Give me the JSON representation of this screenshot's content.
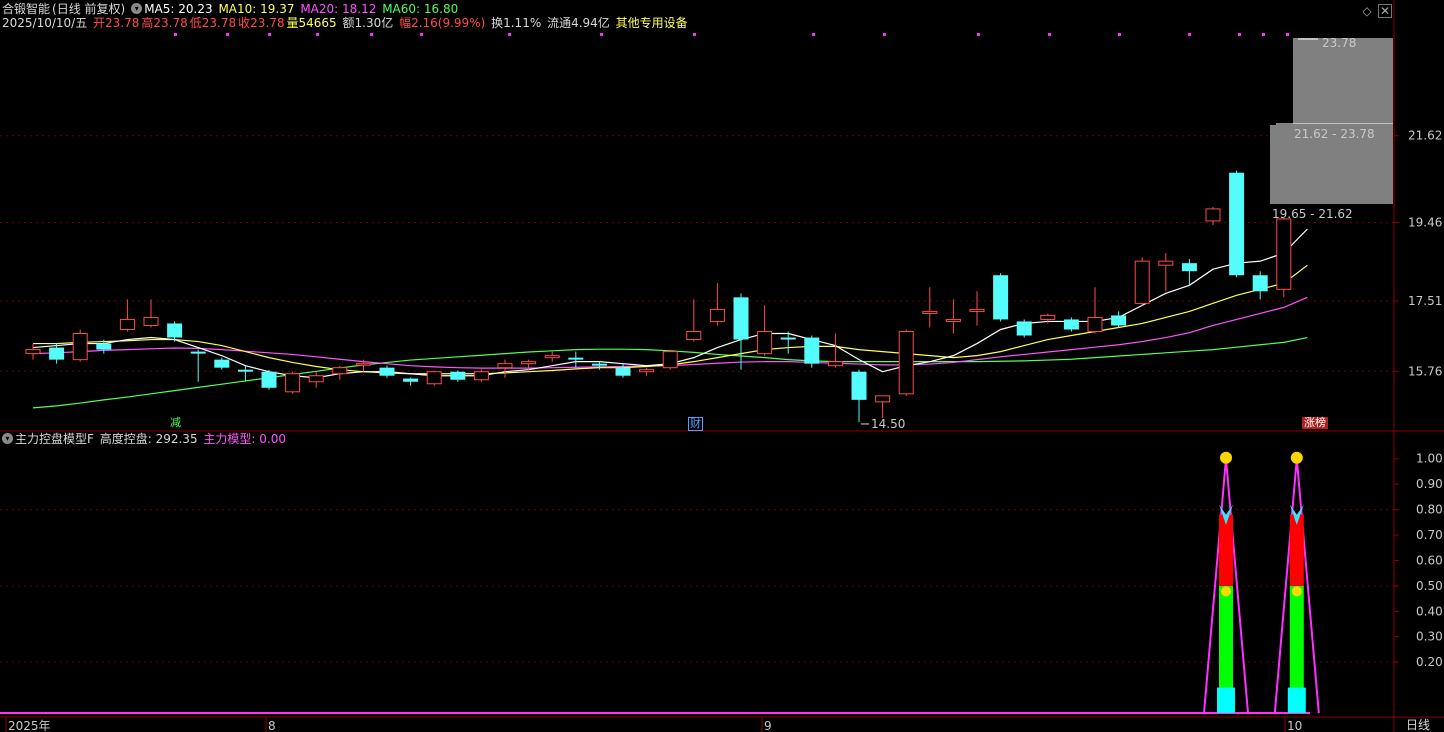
{
  "stock": {
    "name": "合锻智能",
    "period": "(日线 前复权)",
    "ma5_label": "MA5: 20.23",
    "ma10_label": "MA10: 19.37",
    "ma20_label": "MA20: 18.12",
    "ma60_label": "MA60: 16.80"
  },
  "info": {
    "date": "2025/10/10/五",
    "open": "开23.78",
    "high": "高23.78",
    "low": "低23.78",
    "close": "收23.78",
    "volume": "量54665",
    "amount": "额1.30亿",
    "change": "幅2.16(9.99%)",
    "turnover": "换1.11%",
    "float": "流通4.94亿",
    "industry": "其他专用设备"
  },
  "indicator": {
    "name": "主力控盘模型F",
    "item1": "高度控盘: 292.35",
    "item2": "主力模型: 0.00"
  },
  "price_axis": [
    "21.62",
    "19.46",
    "17.51",
    "15.76"
  ],
  "ind_axis": [
    "1.00",
    "0.90",
    "0.80",
    "0.70",
    "0.60",
    "0.50",
    "0.40",
    "0.30",
    "0.20"
  ],
  "time_axis": [
    "2025年",
    "8",
    "9",
    "10"
  ],
  "period_button": "日线",
  "price_box_labels": {
    "top": "23.78",
    "range1": "21.62 - 23.78",
    "range2": "19.65 - 21.62"
  },
  "low_marker": "14.50",
  "event_marks": {
    "jian": "减",
    "cai": "财",
    "zhangbang": "涨榜"
  },
  "colors": {
    "up": "#ff4a4a",
    "down": "#54fcfc",
    "ma5": "#ffffff",
    "ma10": "#ffff54",
    "ma20": "#ff54ff",
    "ma60": "#54ff54",
    "grid": "#8b0000"
  },
  "chart_data": {
    "type": "candlestick",
    "price_ylim": [
      14.3,
      24.2
    ],
    "candles": [
      {
        "o": 16.2,
        "c": 16.3,
        "h": 16.45,
        "l": 16.05
      },
      {
        "o": 16.35,
        "c": 16.05,
        "h": 16.45,
        "l": 15.95
      },
      {
        "o": 16.05,
        "c": 16.7,
        "h": 16.8,
        "l": 16.0
      },
      {
        "o": 16.45,
        "c": 16.3,
        "h": 16.55,
        "l": 16.2
      },
      {
        "o": 16.8,
        "c": 17.05,
        "h": 17.55,
        "l": 16.75
      },
      {
        "o": 16.9,
        "c": 17.1,
        "h": 17.55,
        "l": 16.85
      },
      {
        "o": 16.95,
        "c": 16.6,
        "h": 17.0,
        "l": 16.5
      },
      {
        "o": 16.25,
        "c": 16.2,
        "h": 16.3,
        "l": 15.5
      },
      {
        "o": 16.05,
        "c": 15.85,
        "h": 16.1,
        "l": 15.8
      },
      {
        "o": 15.8,
        "c": 15.75,
        "h": 15.9,
        "l": 15.5
      },
      {
        "o": 15.75,
        "c": 15.35,
        "h": 15.8,
        "l": 15.3
      },
      {
        "o": 15.25,
        "c": 15.7,
        "h": 15.75,
        "l": 15.2
      },
      {
        "o": 15.5,
        "c": 15.65,
        "h": 15.75,
        "l": 15.35
      },
      {
        "o": 15.7,
        "c": 15.85,
        "h": 15.9,
        "l": 15.55
      },
      {
        "o": 15.95,
        "c": 15.95,
        "h": 16.05,
        "l": 15.75
      },
      {
        "o": 15.85,
        "c": 15.65,
        "h": 15.9,
        "l": 15.6
      },
      {
        "o": 15.58,
        "c": 15.5,
        "h": 15.6,
        "l": 15.4
      },
      {
        "o": 15.45,
        "c": 15.75,
        "h": 15.78,
        "l": 15.4
      },
      {
        "o": 15.75,
        "c": 15.55,
        "h": 15.78,
        "l": 15.5
      },
      {
        "o": 15.55,
        "c": 15.75,
        "h": 15.8,
        "l": 15.5
      },
      {
        "o": 15.85,
        "c": 15.95,
        "h": 16.05,
        "l": 15.6
      },
      {
        "o": 15.95,
        "c": 16.0,
        "h": 16.05,
        "l": 15.8
      },
      {
        "o": 16.1,
        "c": 16.15,
        "h": 16.25,
        "l": 16.0
      },
      {
        "o": 16.1,
        "c": 16.05,
        "h": 16.25,
        "l": 15.85
      },
      {
        "o": 15.95,
        "c": 15.9,
        "h": 16.0,
        "l": 15.8
      },
      {
        "o": 15.85,
        "c": 15.65,
        "h": 15.95,
        "l": 15.6
      },
      {
        "o": 15.75,
        "c": 15.8,
        "h": 15.85,
        "l": 15.65
      },
      {
        "o": 15.85,
        "c": 16.25,
        "h": 16.3,
        "l": 15.8
      },
      {
        "o": 16.55,
        "c": 16.75,
        "h": 17.55,
        "l": 16.5
      },
      {
        "o": 17.0,
        "c": 17.3,
        "h": 17.95,
        "l": 16.9
      },
      {
        "o": 17.6,
        "c": 16.55,
        "h": 17.7,
        "l": 15.8
      },
      {
        "o": 16.2,
        "c": 16.75,
        "h": 17.4,
        "l": 16.15
      },
      {
        "o": 16.6,
        "c": 16.55,
        "h": 16.75,
        "l": 16.2
      },
      {
        "o": 16.6,
        "c": 15.95,
        "h": 16.65,
        "l": 15.85
      },
      {
        "o": 15.9,
        "c": 16.0,
        "h": 16.7,
        "l": 15.85
      },
      {
        "o": 15.75,
        "c": 15.05,
        "h": 15.8,
        "l": 14.5
      },
      {
        "o": 15.0,
        "c": 15.15,
        "h": 15.15,
        "l": 14.6
      },
      {
        "o": 15.2,
        "c": 16.75,
        "h": 16.8,
        "l": 15.15
      },
      {
        "o": 17.2,
        "c": 17.25,
        "h": 17.85,
        "l": 16.85
      },
      {
        "o": 17.0,
        "c": 17.05,
        "h": 17.55,
        "l": 16.7
      },
      {
        "o": 17.25,
        "c": 17.3,
        "h": 17.75,
        "l": 16.9
      },
      {
        "o": 18.15,
        "c": 17.05,
        "h": 18.2,
        "l": 17.0
      },
      {
        "o": 17.0,
        "c": 16.65,
        "h": 17.05,
        "l": 16.6
      },
      {
        "o": 17.05,
        "c": 17.15,
        "h": 17.2,
        "l": 16.95
      },
      {
        "o": 17.05,
        "c": 16.8,
        "h": 17.1,
        "l": 16.75
      },
      {
        "o": 16.75,
        "c": 17.1,
        "h": 17.85,
        "l": 16.7
      },
      {
        "o": 17.15,
        "c": 16.9,
        "h": 17.25,
        "l": 16.85
      },
      {
        "o": 17.45,
        "c": 18.5,
        "h": 18.6,
        "l": 17.4
      },
      {
        "o": 18.4,
        "c": 18.5,
        "h": 18.7,
        "l": 17.75
      },
      {
        "o": 18.45,
        "c": 18.25,
        "h": 18.55,
        "l": 17.9
      },
      {
        "o": 19.5,
        "c": 19.8,
        "h": 19.85,
        "l": 19.4
      },
      {
        "o": 20.7,
        "c": 18.15,
        "h": 20.75,
        "l": 18.1
      },
      {
        "o": 18.15,
        "c": 17.75,
        "h": 18.25,
        "l": 17.55
      },
      {
        "o": 17.8,
        "c": 19.55,
        "h": 19.6,
        "l": 17.6
      }
    ],
    "ma5": [
      16.35,
      16.4,
      16.45,
      16.45,
      16.55,
      16.6,
      16.55,
      16.35,
      16.15,
      15.9,
      15.75,
      15.65,
      15.6,
      15.7,
      15.75,
      15.75,
      15.7,
      15.65,
      15.65,
      15.65,
      15.75,
      15.8,
      15.9,
      16.0,
      16.0,
      15.95,
      15.9,
      15.95,
      16.1,
      16.35,
      16.55,
      16.7,
      16.7,
      16.55,
      16.4,
      16.05,
      15.75,
      15.9,
      16.0,
      16.15,
      16.45,
      16.8,
      16.95,
      17.0,
      17.0,
      17.0,
      17.1,
      17.4,
      17.7,
      17.9,
      18.3,
      18.45,
      18.5,
      18.7,
      19.3
    ],
    "ma10": [
      16.45,
      16.45,
      16.48,
      16.5,
      16.52,
      16.55,
      16.55,
      16.5,
      16.4,
      16.25,
      16.1,
      15.98,
      15.88,
      15.8,
      15.75,
      15.72,
      15.7,
      15.7,
      15.7,
      15.7,
      15.72,
      15.75,
      15.78,
      15.82,
      15.85,
      15.85,
      15.88,
      15.92,
      16.0,
      16.1,
      16.2,
      16.3,
      16.35,
      16.38,
      16.38,
      16.3,
      16.25,
      16.2,
      16.15,
      16.1,
      16.15,
      16.25,
      16.4,
      16.55,
      16.65,
      16.75,
      16.85,
      16.95,
      17.1,
      17.25,
      17.45,
      17.65,
      17.8,
      17.95,
      18.4
    ],
    "ma20": [
      16.2,
      16.22,
      16.25,
      16.28,
      16.3,
      16.32,
      16.34,
      16.33,
      16.3,
      16.26,
      16.22,
      16.18,
      16.12,
      16.06,
      16.0,
      15.95,
      15.9,
      15.87,
      15.85,
      15.84,
      15.84,
      15.84,
      15.85,
      15.86,
      15.87,
      15.88,
      15.89,
      15.9,
      15.93,
      15.96,
      15.99,
      16.0,
      16.0,
      15.98,
      15.96,
      15.94,
      15.92,
      15.92,
      15.94,
      15.98,
      16.05,
      16.12,
      16.18,
      16.24,
      16.3,
      16.36,
      16.42,
      16.5,
      16.6,
      16.72,
      16.9,
      17.05,
      17.2,
      17.35,
      17.6
    ],
    "ma60": [
      14.85,
      14.9,
      14.97,
      15.05,
      15.12,
      15.2,
      15.28,
      15.36,
      15.44,
      15.52,
      15.6,
      15.68,
      15.76,
      15.84,
      15.92,
      15.98,
      16.04,
      16.08,
      16.12,
      16.16,
      16.2,
      16.24,
      16.27,
      16.3,
      16.31,
      16.31,
      16.3,
      16.27,
      16.23,
      16.18,
      16.14,
      16.1,
      16.05,
      16.02,
      16.0,
      16.0,
      16.0,
      16.0,
      16.0,
      16.0,
      16.0,
      16.01,
      16.02,
      16.04,
      16.06,
      16.1,
      16.14,
      16.18,
      16.22,
      16.26,
      16.3,
      16.36,
      16.42,
      16.48,
      16.6
    ],
    "indicator_ylim": [
      0,
      1.05
    ],
    "indicator_series": [
      {
        "x_index": 50,
        "peak": 1.0,
        "green": [
          0.0,
          0.5
        ],
        "red": [
          0.5,
          0.78
        ],
        "cyan_base": 0.1
      },
      {
        "x_index": 53,
        "peak": 1.0,
        "green": [
          0.0,
          0.5
        ],
        "red": [
          0.5,
          0.78
        ],
        "cyan_base": 0.1
      }
    ]
  }
}
